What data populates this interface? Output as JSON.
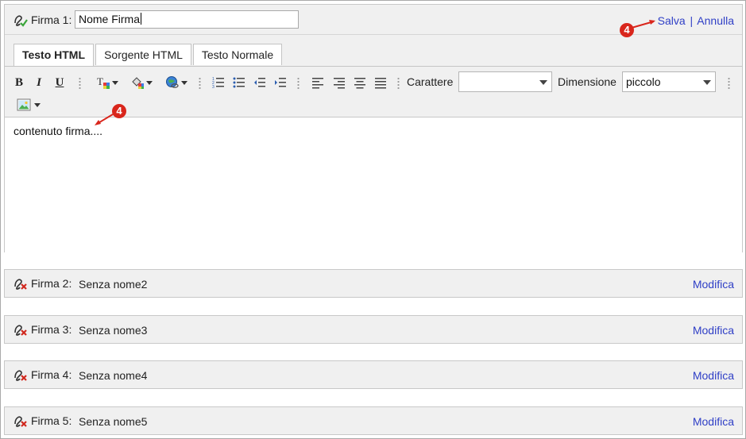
{
  "signature_editor": {
    "label": "Firma 1:",
    "name_value": "Nome Firma",
    "save_label": "Salva",
    "separator": "|",
    "cancel_label": "Annulla",
    "tabs": [
      {
        "label": "Testo HTML",
        "active": true
      },
      {
        "label": "Sorgente HTML",
        "active": false
      },
      {
        "label": "Testo Normale",
        "active": false
      }
    ],
    "toolbar": {
      "bold": "B",
      "italic": "I",
      "underline": "U",
      "font_label": "Carattere",
      "font_value": "",
      "size_label": "Dimensione",
      "size_value": "piccolo"
    },
    "content": "contenuto firma...."
  },
  "signatures": [
    {
      "label": "Firma 2:",
      "name": "Senza nome2",
      "action": "Modifica"
    },
    {
      "label": "Firma 3:",
      "name": "Senza nome3",
      "action": "Modifica"
    },
    {
      "label": "Firma 4:",
      "name": "Senza nome4",
      "action": "Modifica"
    },
    {
      "label": "Firma 5:",
      "name": "Senza nome5",
      "action": "Modifica"
    }
  ],
  "callouts": [
    "4",
    "4"
  ],
  "colors": {
    "link": "#2f3fc6",
    "callout": "#d9261c",
    "check": "#3aa53a",
    "cross": "#d0281e"
  }
}
